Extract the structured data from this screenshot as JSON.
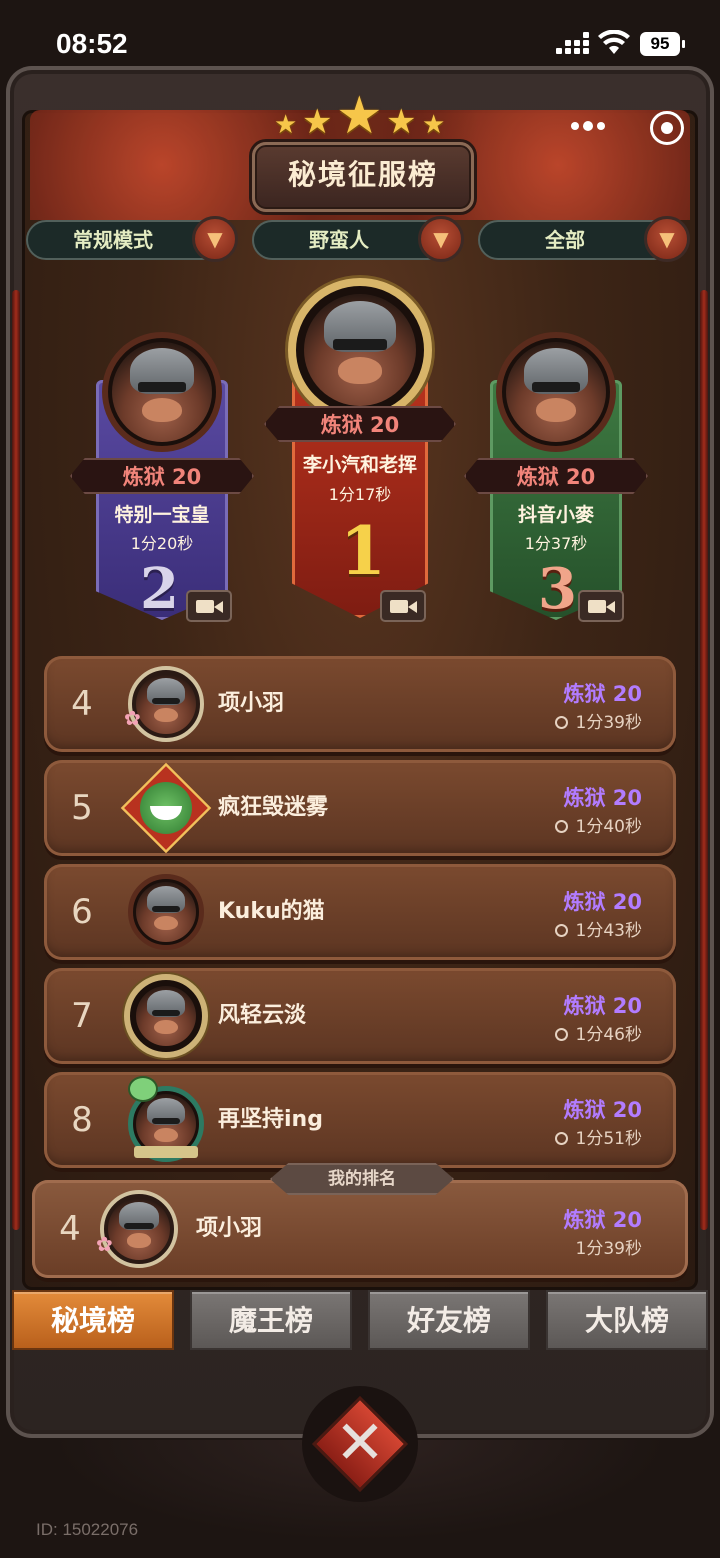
{
  "status_bar": {
    "time": "08:52",
    "battery": "95"
  },
  "header": {
    "title": "秘境征服榜"
  },
  "filters": [
    {
      "label": "常规模式"
    },
    {
      "label": "野蛮人"
    },
    {
      "label": "全部"
    }
  ],
  "podium": {
    "first": {
      "tier": "炼狱 20",
      "name": "李小汽和老挥",
      "time": "1分17秒",
      "rank": "1"
    },
    "second": {
      "tier": "炼狱 20",
      "name": "特别一宝皇",
      "time": "1分20秒",
      "rank": "2"
    },
    "third": {
      "tier": "炼狱 20",
      "name": "抖音小麥",
      "time": "1分37秒",
      "rank": "3"
    }
  },
  "rankings": [
    {
      "rank": "4",
      "name": "项小羽",
      "tier": "炼狱 20",
      "time": "1分39秒"
    },
    {
      "rank": "5",
      "name": "疯狂毁迷雾",
      "tier": "炼狱 20",
      "time": "1分40秒"
    },
    {
      "rank": "6",
      "name": "Kuku的猫",
      "tier": "炼狱 20",
      "time": "1分43秒"
    },
    {
      "rank": "7",
      "name": "风轻云淡",
      "tier": "炼狱 20",
      "time": "1分46秒"
    },
    {
      "rank": "8",
      "name": "再坚持ing",
      "tier": "炼狱 20",
      "time": "1分51秒"
    }
  ],
  "my_rank": {
    "label": "我的排名",
    "rank": "4",
    "name": "项小羽",
    "tier": "炼狱 20",
    "time": "1分39秒"
  },
  "tabs": [
    {
      "label": "秘境榜",
      "active": true
    },
    {
      "label": "魔王榜",
      "active": false
    },
    {
      "label": "好友榜",
      "active": false
    },
    {
      "label": "大队榜",
      "active": false
    }
  ],
  "footer": {
    "id_text": "ID: 15022076"
  },
  "colors": {
    "tier_purple": "#b27cff",
    "tier_red": "#f1847a",
    "tab_active": "#d7792e"
  }
}
